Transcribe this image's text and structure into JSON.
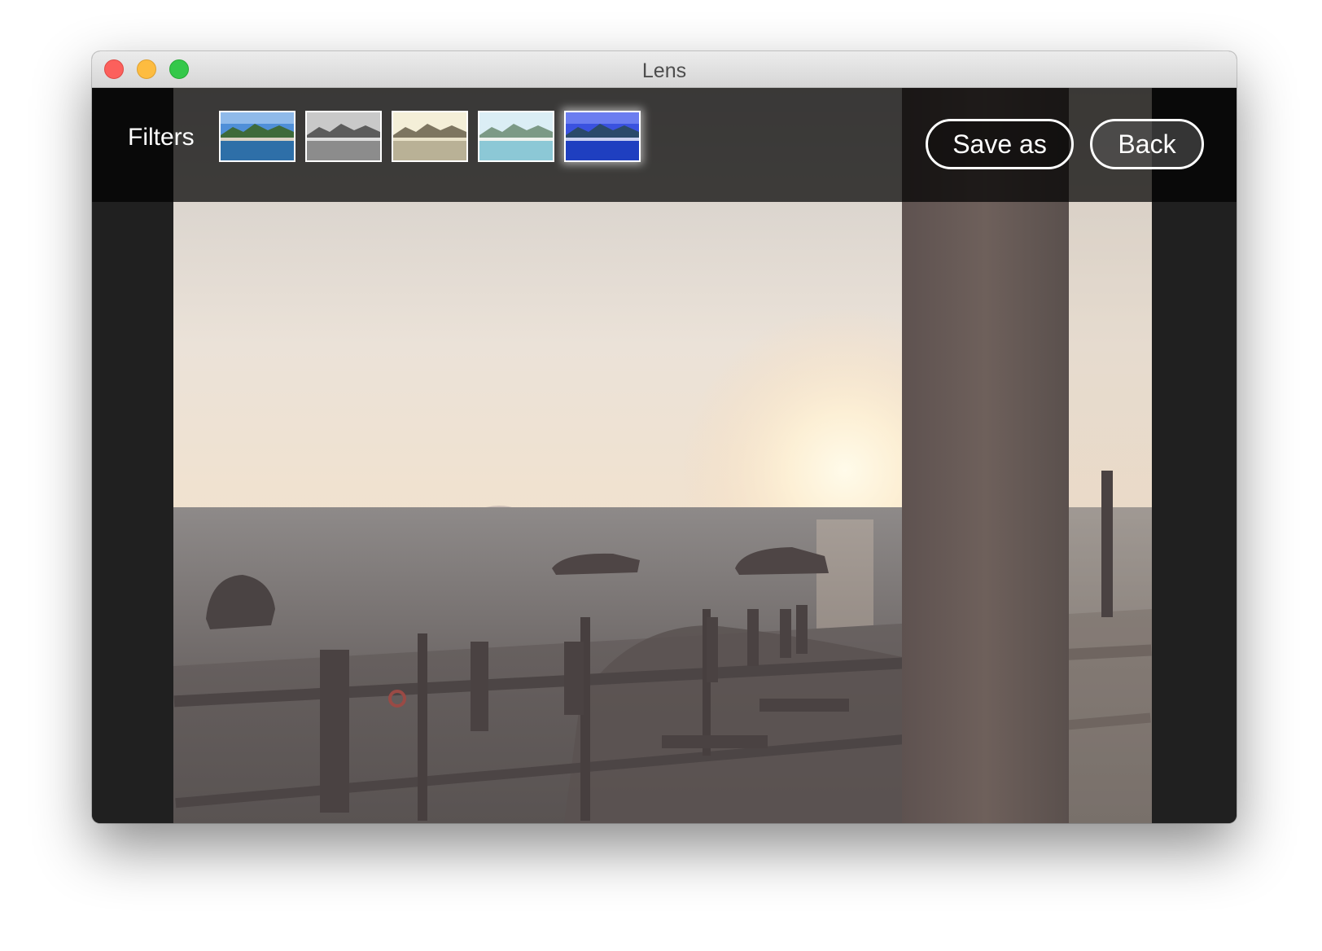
{
  "window": {
    "title": "Lens"
  },
  "toolbar": {
    "filters_label": "Filters",
    "filters": [
      {
        "name": "original",
        "selected": false
      },
      {
        "name": "mono",
        "selected": false
      },
      {
        "name": "sepia",
        "selected": false
      },
      {
        "name": "fade",
        "selected": false
      },
      {
        "name": "vivid-blue",
        "selected": true
      }
    ],
    "save_label": "Save as",
    "back_label": "Back"
  },
  "photo": {
    "subject": "sunset-over-sea"
  }
}
